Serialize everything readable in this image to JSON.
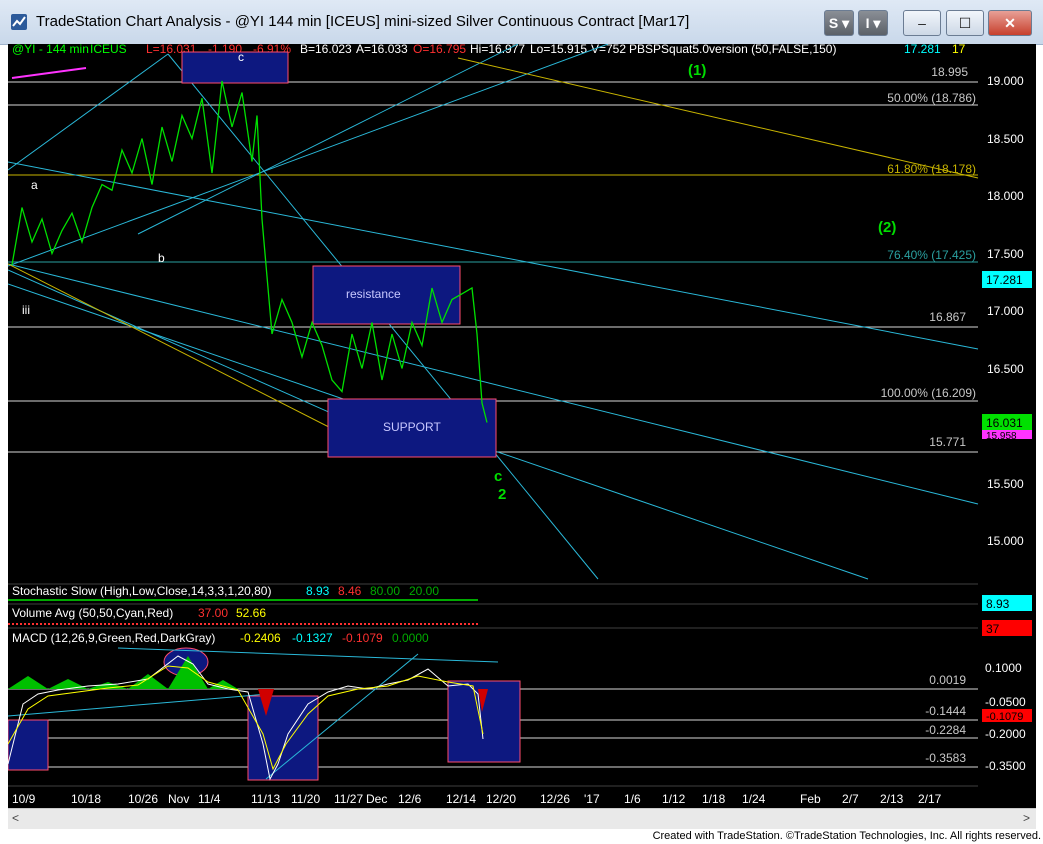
{
  "window": {
    "title": "TradeStation Chart Analysis - @YI 144 min [ICEUS] mini-sized Silver Continuous Contract [Mar17]",
    "buttons": {
      "s": "S",
      "i": "I",
      "minimize": "–",
      "maximize": "☐",
      "close": "✕"
    }
  },
  "header": {
    "symbol": "@YI - 144 min",
    "exchange": "ICEUS",
    "last": "L=16.031",
    "change": "-1.190",
    "change_pct": "-6.91%",
    "bid": "B=16.023",
    "ask": "A=16.033",
    "open": "O=16.795",
    "high": "Hi=16.977",
    "low": "Lo=15.915",
    "volume": "V=752",
    "indicator": "PBSPSquat5.0version (50,FALSE,150)",
    "ind_val1": "17.281",
    "ind_val2": "17"
  },
  "price_axis": {
    "ticks": [
      "19.000",
      "18.500",
      "18.000",
      "17.500",
      "17.000",
      "16.500",
      "16.000",
      "15.500",
      "15.000"
    ],
    "last_price_tag": "16.031",
    "upper_tag": "17.281",
    "lower_tag": "15.958"
  },
  "levels": {
    "l1": "18.995",
    "l2": "50.00% (18.786)",
    "l3": "61.80% (18.178)",
    "l4": "76.40% (17.425)",
    "l5": "16.867",
    "l6": "100.00% (16.209)",
    "l7": "15.771"
  },
  "annotations": {
    "wave1": "(1)",
    "wave2": "(2)",
    "a": "a",
    "b": "b",
    "c_top": "c",
    "iii": "iii",
    "resistance": "resistance",
    "support": "SUPPORT",
    "c_bottom": "c",
    "two": "2"
  },
  "stochastic": {
    "label": "Stochastic Slow (High,Low,Close,14,3,3,1,20,80)",
    "v1": "8.93",
    "v2": "8.46",
    "v3": "80.00",
    "v4": "20.00",
    "tag": "8.93"
  },
  "volume": {
    "label": "Volume Avg (50,50,Cyan,Red)",
    "v1": "37.00",
    "v2": "52.66",
    "tag": "37"
  },
  "macd": {
    "label": "MACD (12,26,9,Green,Red,DarkGray)",
    "v1": "-0.2406",
    "v2": "-0.1327",
    "v3": "-0.1079",
    "v4": "0.0000",
    "ticks": [
      "0.1000",
      "-0.0500",
      "-0.2000",
      "-0.3500"
    ],
    "levels": [
      "0.0019",
      "-0.1444",
      "-0.2284",
      "-0.3583"
    ],
    "tag": "-0.1079"
  },
  "date_axis": [
    "10/9",
    "10/18",
    "10/26",
    "Nov",
    "11/4",
    "11/13",
    "11/20",
    "11/27",
    "Dec",
    "12/6",
    "12/14",
    "12/20",
    "12/26",
    "'17",
    "1/6",
    "1/12",
    "1/18",
    "1/24",
    "Feb",
    "2/7",
    "2/13",
    "2/17"
  ],
  "footer": "Created with TradeStation. ©TradeStation Technologies, Inc. All rights reserved.",
  "chart_data": {
    "type": "line",
    "title": "@YI - 144 min",
    "ylim": [
      14.5,
      19.3
    ],
    "price_path": [
      [
        0,
        17.4
      ],
      [
        10,
        17.9
      ],
      [
        20,
        17.6
      ],
      [
        30,
        17.8
      ],
      [
        40,
        17.5
      ],
      [
        50,
        17.7
      ],
      [
        60,
        17.85
      ],
      [
        70,
        17.6
      ],
      [
        80,
        17.9
      ],
      [
        90,
        18.1
      ],
      [
        100,
        18.05
      ],
      [
        110,
        18.4
      ],
      [
        120,
        18.2
      ],
      [
        130,
        18.5
      ],
      [
        140,
        18.1
      ],
      [
        150,
        18.6
      ],
      [
        160,
        18.3
      ],
      [
        170,
        18.7
      ],
      [
        180,
        18.5
      ],
      [
        190,
        18.85
      ],
      [
        200,
        18.2
      ],
      [
        210,
        19.0
      ],
      [
        220,
        18.6
      ],
      [
        230,
        18.9
      ],
      [
        240,
        18.3
      ],
      [
        245,
        18.7
      ],
      [
        250,
        17.8
      ],
      [
        255,
        17.3
      ],
      [
        260,
        16.8
      ],
      [
        270,
        17.1
      ],
      [
        280,
        16.9
      ],
      [
        290,
        16.6
      ],
      [
        300,
        16.9
      ],
      [
        310,
        16.7
      ],
      [
        320,
        16.4
      ],
      [
        330,
        16.3
      ],
      [
        340,
        16.8
      ],
      [
        350,
        16.5
      ],
      [
        360,
        16.9
      ],
      [
        370,
        16.4
      ],
      [
        380,
        16.8
      ],
      [
        390,
        16.5
      ],
      [
        400,
        16.9
      ],
      [
        410,
        16.7
      ],
      [
        420,
        17.2
      ],
      [
        430,
        16.9
      ],
      [
        440,
        17.1
      ],
      [
        450,
        17.15
      ],
      [
        460,
        17.2
      ],
      [
        465,
        16.8
      ],
      [
        470,
        16.2
      ],
      [
        475,
        16.03
      ]
    ]
  }
}
